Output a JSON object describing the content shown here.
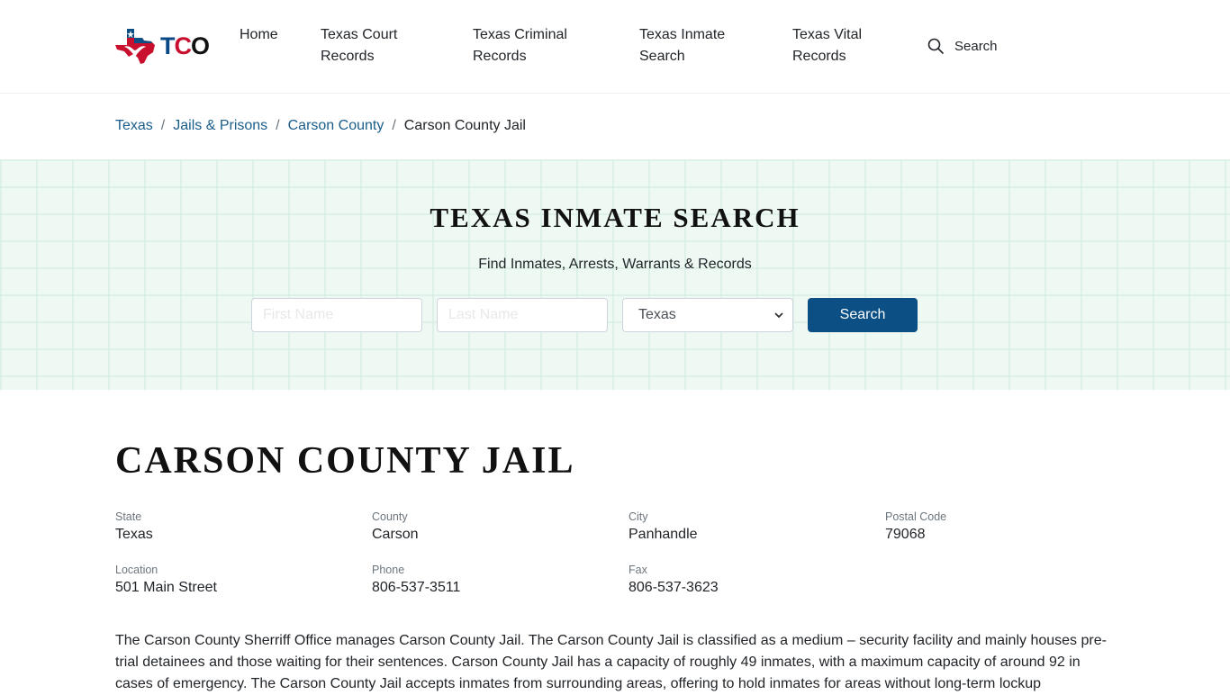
{
  "header": {
    "logo_text": [
      "T",
      "C",
      "O"
    ],
    "nav": [
      {
        "label": "Home"
      },
      {
        "label": "Texas Court Records"
      },
      {
        "label": "Texas Criminal Records"
      },
      {
        "label": "Texas Inmate Search"
      },
      {
        "label": "Texas Vital Records"
      }
    ],
    "search_label": "Search"
  },
  "breadcrumb": {
    "items": [
      "Texas",
      "Jails & Prisons",
      "Carson County"
    ],
    "separator": "/",
    "current": "Carson County Jail"
  },
  "hero": {
    "title": "TEXAS INMATE SEARCH",
    "subtitle": "Find Inmates, Arrests, Warrants & Records",
    "first_name_placeholder": "First Name",
    "last_name_placeholder": "Last Name",
    "state_selected": "Texas",
    "search_button": "Search"
  },
  "facility": {
    "title": "CARSON COUNTY JAIL",
    "fields": [
      {
        "label": "State",
        "value": "Texas"
      },
      {
        "label": "County",
        "value": "Carson"
      },
      {
        "label": "City",
        "value": "Panhandle"
      },
      {
        "label": "Postal Code",
        "value": "79068"
      },
      {
        "label": "Location",
        "value": "501 Main Street"
      },
      {
        "label": "Phone",
        "value": "806-537-3511"
      },
      {
        "label": "Fax",
        "value": "806-537-3623"
      }
    ],
    "description": "The Carson County Sherriff Office manages Carson County Jail. The Carson County Jail is classified as a medium – security facility and mainly houses pre-trial detainees and those waiting for their sentences. Carson County Jail has a capacity of roughly 49 inmates, with a maximum capacity of around 92 in cases of emergency. The Carson County Jail accepts inmates from surrounding areas, offering to hold inmates for areas without long-term lockup"
  },
  "colors": {
    "brand_blue": "#0b4f85",
    "brand_red": "#c8102e",
    "link": "#1a5d8a",
    "hero_bg": "#eef9f4"
  }
}
